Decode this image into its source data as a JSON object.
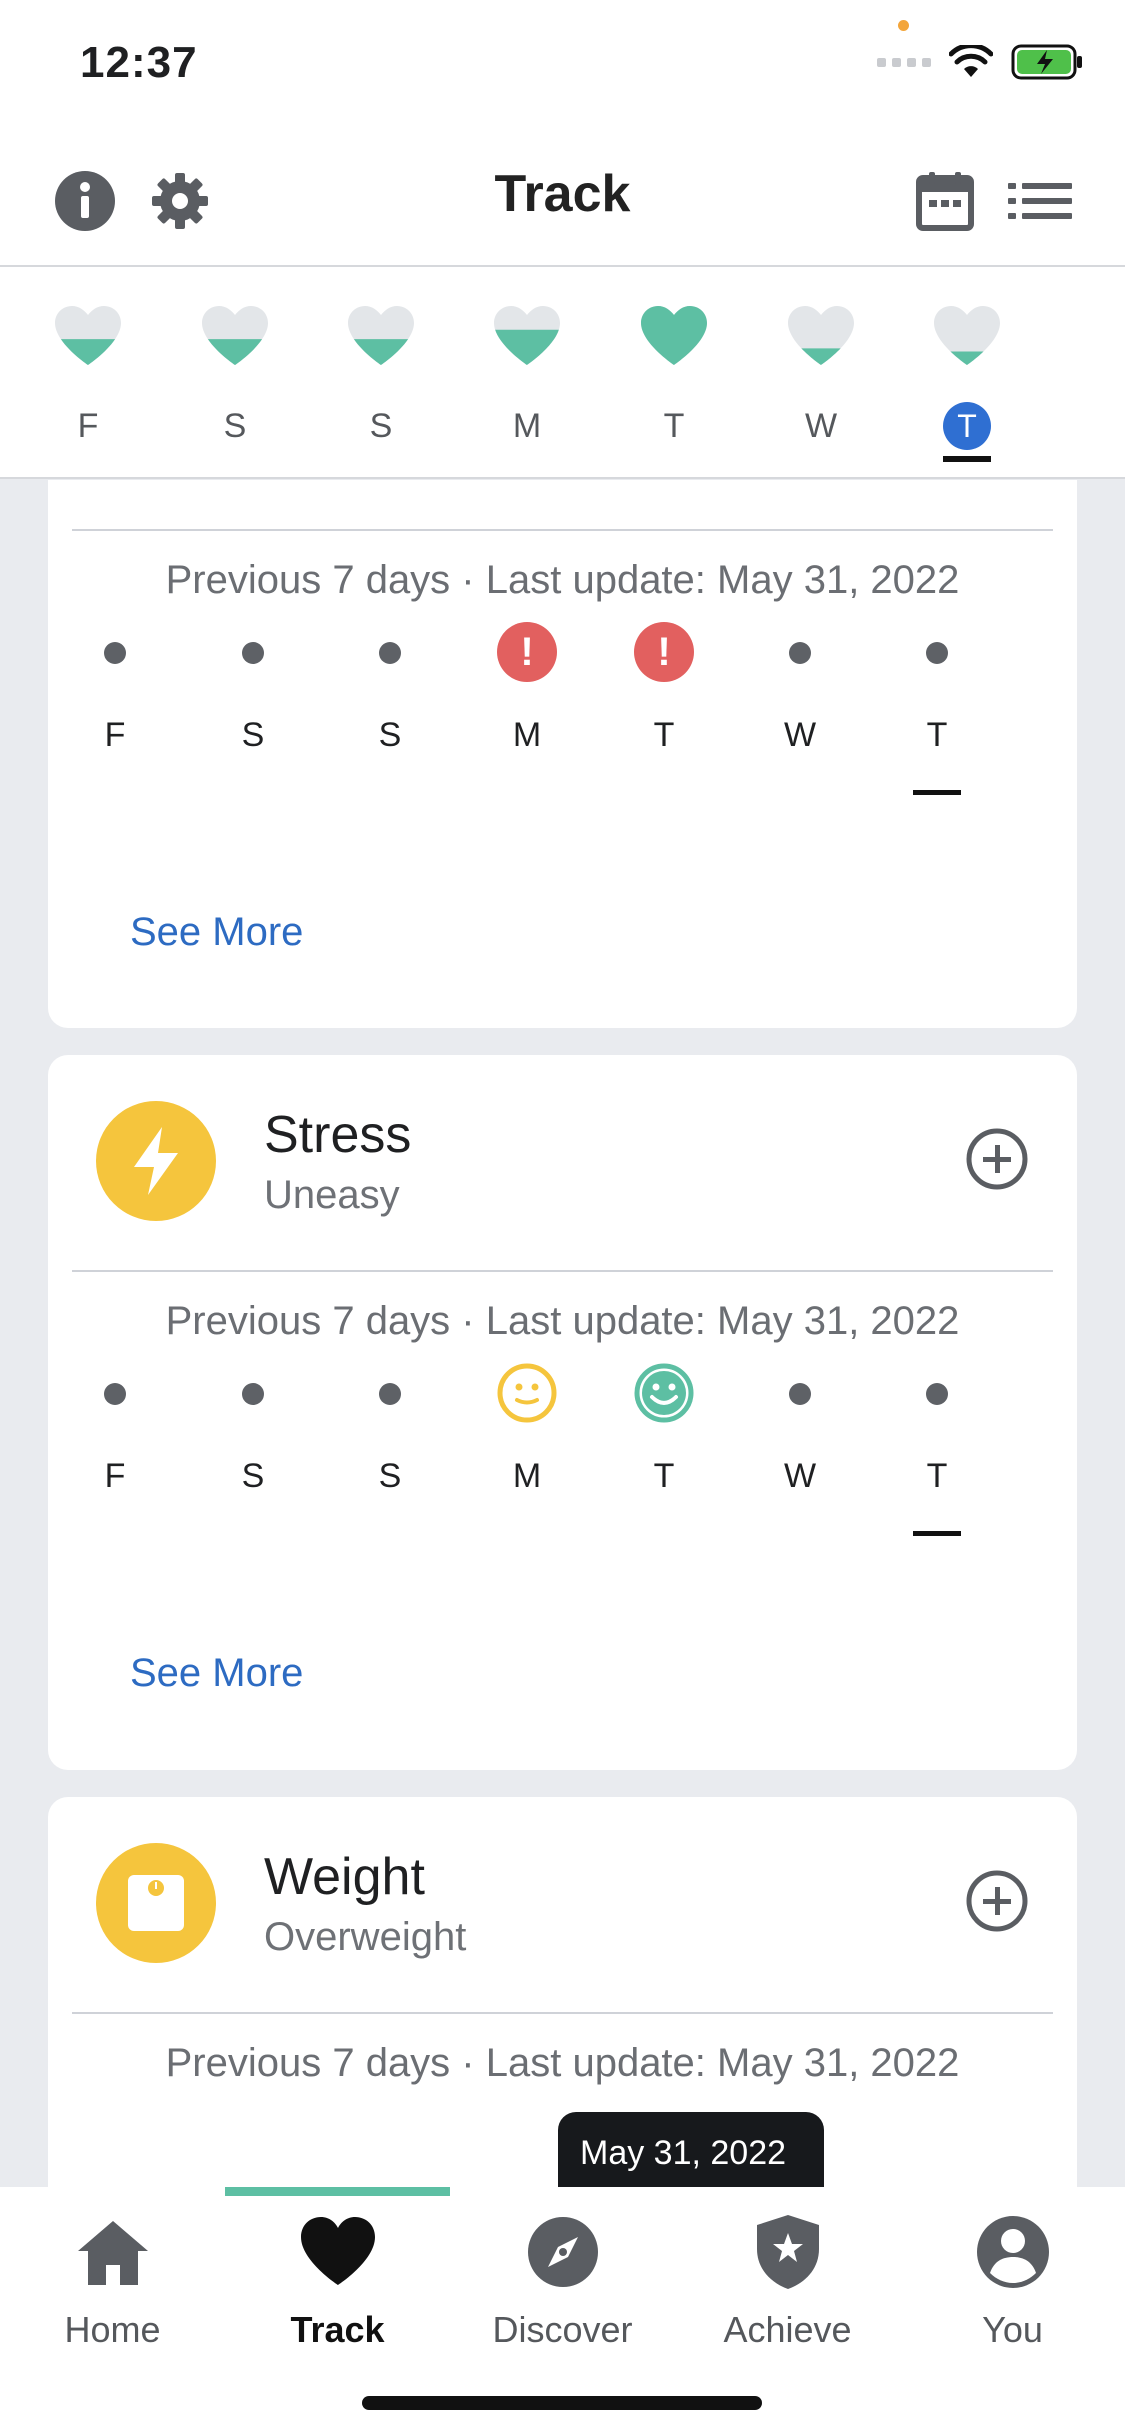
{
  "status_bar": {
    "time": "12:37"
  },
  "header": {
    "title": "Track"
  },
  "week": [
    {
      "label": "F",
      "fill": 0.45
    },
    {
      "label": "S",
      "fill": 0.45
    },
    {
      "label": "S",
      "fill": 0.45
    },
    {
      "label": "M",
      "fill": 0.6
    },
    {
      "label": "T",
      "fill": 1.0
    },
    {
      "label": "W",
      "fill": 0.3
    },
    {
      "label": "T",
      "fill": 0.25,
      "selected": true
    }
  ],
  "card1": {
    "prev_line": "Previous 7 days · Last update: May 31, 2022",
    "days": [
      "F",
      "S",
      "S",
      "M",
      "T",
      "W",
      "T"
    ],
    "see_more": "See More",
    "alert_glyph": "!"
  },
  "card2": {
    "title": "Stress",
    "subtitle": "Uneasy",
    "prev_line": "Previous 7 days · Last update: May 31, 2022",
    "days": [
      "F",
      "S",
      "S",
      "M",
      "T",
      "W",
      "T"
    ],
    "see_more": "See More"
  },
  "card3": {
    "title": "Weight",
    "subtitle": "Overweight",
    "prev_line": "Previous 7 days · Last update: May 31, 2022"
  },
  "tooltip": {
    "date": "May 31, 2022"
  },
  "nav": [
    {
      "label": "Home",
      "icon": "home-icon"
    },
    {
      "label": "Track",
      "icon": "heart-icon",
      "active": true
    },
    {
      "label": "Discover",
      "icon": "compass-icon"
    },
    {
      "label": "Achieve",
      "icon": "shield-star-icon"
    },
    {
      "label": "You",
      "icon": "profile-icon"
    }
  ],
  "colors": {
    "heart_fill": "#5dbfa3",
    "heart_empty": "#e3e6e9",
    "accent_yellow": "#f5c53d",
    "alert_red": "#e2605f",
    "link_blue": "#2d6bc2",
    "selected_blue": "#2f6fd2",
    "mood_yellow": "#f5c53d",
    "mood_green": "#5dbfa3"
  }
}
